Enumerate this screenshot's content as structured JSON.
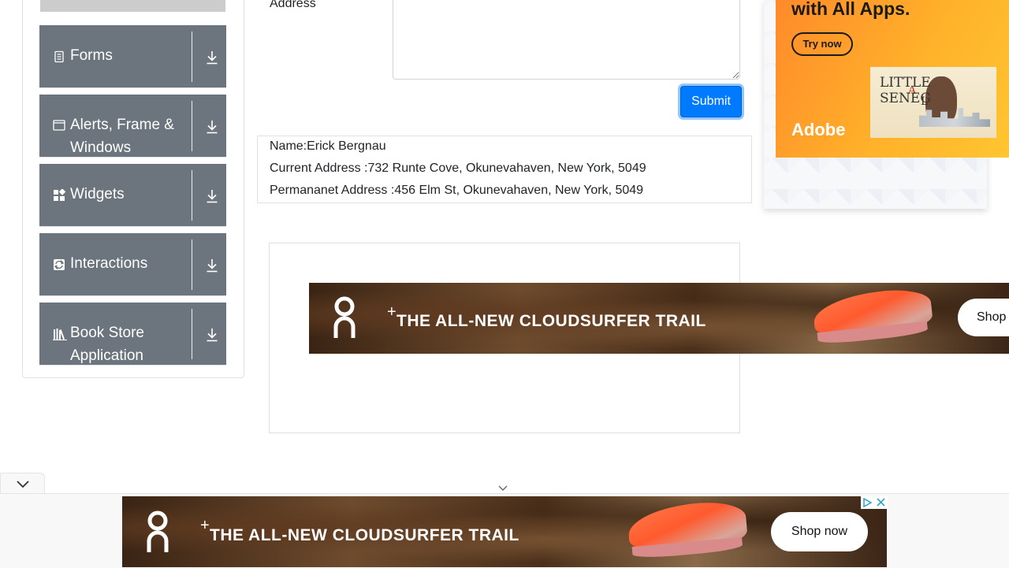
{
  "sidebar": {
    "groups": [
      {
        "title": "Forms",
        "icon": "document-icon"
      },
      {
        "title": "Alerts, Frame & Windows",
        "icon": "window-icon"
      },
      {
        "title": "Widgets",
        "icon": "widgets-icon"
      },
      {
        "title": "Interactions",
        "icon": "interactions-icon"
      },
      {
        "title": "Book Store Application",
        "icon": "books-icon"
      }
    ],
    "expand_icon": "download-arrow-icon"
  },
  "form": {
    "address_label": "Address",
    "submit_label": "Submit"
  },
  "output": {
    "name": "Name:Erick Bergnau",
    "current_address": "Current Address :732 Runte Cove, Okunevahaven, New York, 5049",
    "permanent_address": "Permananet Address :456 Elm St, Okunevahaven, New York, 5049"
  },
  "ads": {
    "adobe": {
      "headline": "with All Apps.",
      "cta": "Try now",
      "brand": "Adobe",
      "book_title_line1": "LITTLE",
      "book_title_line2": "SENEG",
      "book_title_a": "A",
      "book_title_l": "L"
    },
    "on_running": {
      "logo": "On",
      "plus": "+",
      "headline": "THE ALL-NEW CLOUDSURFER TRAIL",
      "cta_partial": "Shop",
      "cta": "Shop now"
    }
  },
  "colors": {
    "sidebar_group_bg": "#6c757d",
    "submit_bg": "#007bff",
    "adobe_bg": "#ffb12a"
  }
}
